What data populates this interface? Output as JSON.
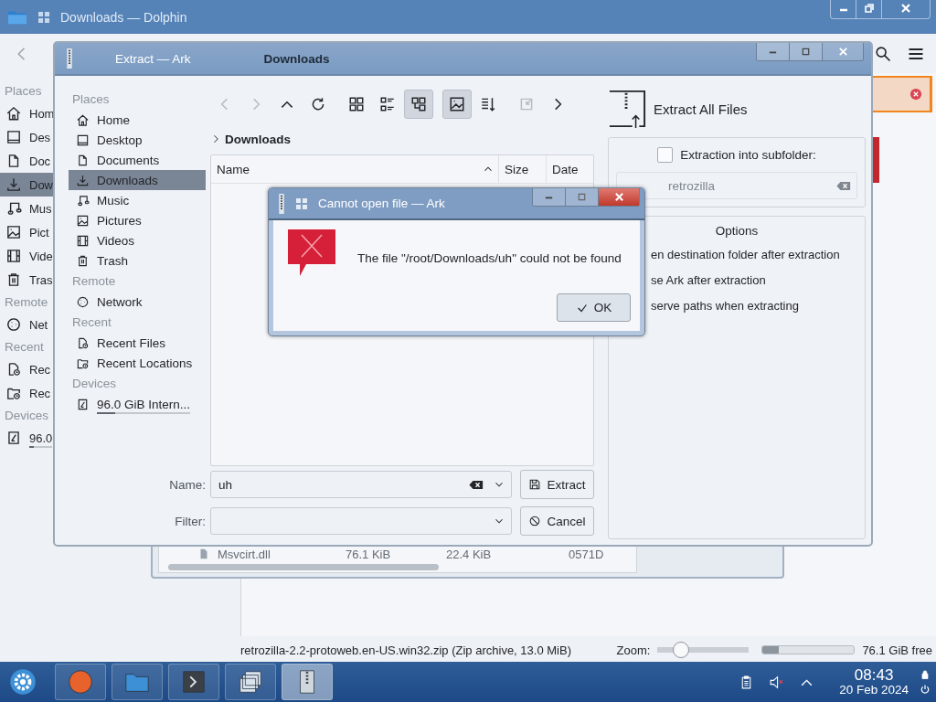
{
  "dolphin": {
    "title": "Downloads — Dolphin",
    "breadcrumb": "Downloads",
    "sidebar": [
      {
        "heading": "Places",
        "items": [
          {
            "label": "Hom",
            "selected": false
          },
          {
            "label": "Des",
            "selected": false
          },
          {
            "label": "Doc",
            "selected": false
          },
          {
            "label": "Dow",
            "selected": true
          },
          {
            "label": "Mus",
            "selected": false
          },
          {
            "label": "Pict",
            "selected": false
          },
          {
            "label": "Vide",
            "selected": false
          },
          {
            "label": "Tras",
            "selected": false
          }
        ]
      },
      {
        "heading": "Remote",
        "items": [
          {
            "label": "Net",
            "selected": false
          }
        ]
      },
      {
        "heading": "Recent",
        "items": [
          {
            "label": "Rec",
            "selected": false
          },
          {
            "label": "Rec",
            "selected": false
          }
        ]
      },
      {
        "heading": "Devices",
        "items": [
          {
            "label": "96.0",
            "selected": false,
            "level": 0.2
          }
        ]
      }
    ],
    "status_bar": {
      "text": "retrozilla-2.2-protoweb.en-US.win32.zip (Zip archive, 13.0 MiB)",
      "zoom_label": "Zoom:",
      "zoom": {
        "level": 0.2
      },
      "space": {
        "level": 0.18
      },
      "free": "76.1 GiB free"
    }
  },
  "archive_window": {
    "row": [
      "Msvcirt.dll",
      "76.1 KiB",
      "22.4 KiB",
      "0571D"
    ]
  },
  "extract_window": {
    "title": "Extract — Ark",
    "toolbar": [
      {
        "selected": false,
        "disabled": true
      },
      {
        "selected": false,
        "disabled": true
      },
      {
        "selected": false,
        "disabled": false
      },
      {
        "selected": false,
        "disabled": false
      },
      {
        "selected": false,
        "disabled": false
      },
      {
        "selected": false,
        "disabled": false
      },
      {
        "selected": true,
        "disabled": false
      },
      {
        "selected": true,
        "disabled": false
      },
      {
        "selected": false,
        "disabled": false
      },
      {
        "selected": false,
        "disabled": true
      },
      {
        "selected": false,
        "disabled": false
      }
    ],
    "sidebar": [
      {
        "heading": "Places",
        "items": [
          {
            "label": "Home",
            "selected": false
          },
          {
            "label": "Desktop",
            "selected": false
          },
          {
            "label": "Documents",
            "selected": false
          },
          {
            "label": "Downloads",
            "selected": true
          },
          {
            "label": "Music",
            "selected": false
          },
          {
            "label": "Pictures",
            "selected": false
          },
          {
            "label": "Videos",
            "selected": false
          },
          {
            "label": "Trash",
            "selected": false
          }
        ]
      },
      {
        "heading": "Remote",
        "items": [
          {
            "label": "Network",
            "selected": false
          }
        ]
      },
      {
        "heading": "Recent",
        "items": [
          {
            "label": "Recent Files",
            "selected": false
          },
          {
            "label": "Recent Locations",
            "selected": false
          }
        ]
      },
      {
        "heading": "Devices",
        "items": [
          {
            "label": "96.0 GiB Intern...",
            "selected": false,
            "level": 0.2
          }
        ]
      }
    ],
    "breadcrumb": "Downloads",
    "columns": [
      "Name",
      "Size",
      "Date"
    ],
    "name_label": "Name:",
    "name_value": "uh",
    "filter_label": "Filter:",
    "buttons": [
      "Extract",
      "Cancel"
    ],
    "heading": "Extract All Files",
    "subfolder": {
      "label": "Extraction into subfolder:",
      "checked": false,
      "value": "retrozilla"
    },
    "options_title": "Options",
    "options": [
      "en destination folder after extraction",
      "se Ark after extraction",
      "serve paths when extracting"
    ]
  },
  "error_dialog": {
    "title": "Cannot open file — Ark",
    "message": "The file \"/root/Downloads/uh\" could not be found",
    "button": "OK"
  },
  "taskbar": {
    "apps": [
      {
        "selected": false
      },
      {
        "selected": false
      },
      {
        "selected": false
      },
      {
        "selected": false
      },
      {
        "selected": true
      }
    ],
    "time": "08:43",
    "date": "20 Feb 2024"
  }
}
